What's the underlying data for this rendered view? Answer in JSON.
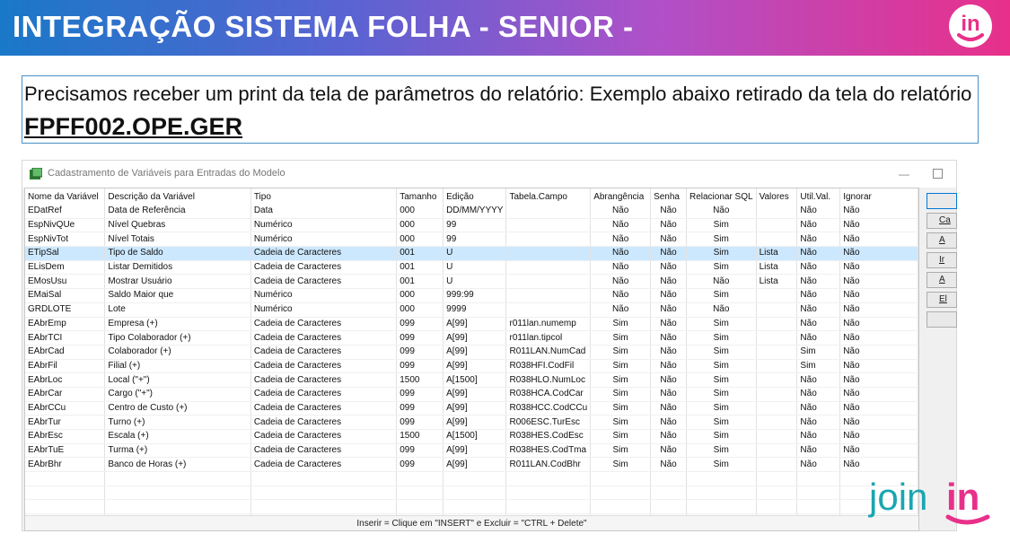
{
  "banner": {
    "title": "INTEGRAÇÃO SISTEMA FOLHA - SENIOR -"
  },
  "callout": {
    "text": "Precisamos receber um print da tela de parâmetros do relatório: Exemplo abaixo retirado da tela do relatório ",
    "report": "FPFF002.OPE.GER"
  },
  "window": {
    "title": "Cadastramento de Variáveis para Entradas do Modelo",
    "minimize": "—",
    "status": "Inserir = Clique em \"INSERT\"  e  Excluir = \"CTRL + Delete\""
  },
  "grid": {
    "columns": [
      "Nome da Variável",
      "Descrição da Variável",
      "Tipo",
      "Tamanho",
      "Edição",
      "Tabela.Campo",
      "Abrangência",
      "Senha",
      "Relacionar SQL",
      "Valores",
      "Util.Val.",
      "Ignorar"
    ],
    "rows": [
      [
        "EDatRef",
        "Data de Referência",
        "Data",
        "000",
        "DD/MM/YYYY",
        "",
        "Não",
        "Não",
        "Não",
        "",
        "Não",
        "Não"
      ],
      [
        "EspNivQUe",
        "Nível Quebras",
        "Numérico",
        "000",
        "99",
        "",
        "Não",
        "Não",
        "Sim",
        "",
        "Não",
        "Não"
      ],
      [
        "EspNivTot",
        "Nível Totais",
        "Numérico",
        "000",
        "99",
        "",
        "Não",
        "Não",
        "Sim",
        "",
        "Não",
        "Não"
      ],
      [
        "ETipSal",
        "Tipo de Saldo",
        "Cadeia de Caracteres",
        "001",
        "U",
        "",
        "Não",
        "Não",
        "Sim",
        "Lista",
        "Não",
        "Não"
      ],
      [
        "ELisDem",
        "Listar Demitidos",
        "Cadeia de Caracteres",
        "001",
        "U",
        "",
        "Não",
        "Não",
        "Sim",
        "Lista",
        "Não",
        "Não"
      ],
      [
        "EMosUsu",
        "Mostrar Usuário",
        "Cadeia de Caracteres",
        "001",
        "U",
        "",
        "Não",
        "Não",
        "Não",
        "Lista",
        "Não",
        "Não"
      ],
      [
        "EMaiSal",
        "Saldo Maior que",
        "Numérico",
        "000",
        "999:99",
        "",
        "Não",
        "Não",
        "Sim",
        "",
        "Não",
        "Não"
      ],
      [
        "GRDLOTE",
        "Lote",
        "Numérico",
        "000",
        "9999",
        "",
        "Não",
        "Não",
        "Não",
        "",
        "Não",
        "Não"
      ],
      [
        "EAbrEmp",
        "Empresa (+)",
        "Cadeia de Caracteres",
        "099",
        "A[99]",
        "r011lan.numemp",
        "Sim",
        "Não",
        "Sim",
        "",
        "Não",
        "Não"
      ],
      [
        "EAbrTCI",
        "Tipo Colaborador (+)",
        "Cadeia de Caracteres",
        "099",
        "A[99]",
        "r011lan.tipcol",
        "Sim",
        "Não",
        "Sim",
        "",
        "Não",
        "Não"
      ],
      [
        "EAbrCad",
        "Colaborador (+)",
        "Cadeia de Caracteres",
        "099",
        "A[99]",
        "R011LAN.NumCad",
        "Sim",
        "Não",
        "Sim",
        "",
        "Sim",
        "Não"
      ],
      [
        "EAbrFil",
        "Filial (+)",
        "Cadeia de Caracteres",
        "099",
        "A[99]",
        "R038HFI.CodFil",
        "Sim",
        "Não",
        "Sim",
        "",
        "Sim",
        "Não"
      ],
      [
        "EAbrLoc",
        "Local (\"+\")",
        "Cadeia de Caracteres",
        "1500",
        "A[1500]",
        "R038HLO.NumLoc",
        "Sim",
        "Não",
        "Sim",
        "",
        "Não",
        "Não"
      ],
      [
        "EAbrCar",
        "Cargo (\"+\")",
        "Cadeia de Caracteres",
        "099",
        "A[99]",
        "R038HCA.CodCar",
        "Sim",
        "Não",
        "Sim",
        "",
        "Não",
        "Não"
      ],
      [
        "EAbrCCu",
        "Centro de Custo (+)",
        "Cadeia de Caracteres",
        "099",
        "A[99]",
        "R038HCC.CodCCu",
        "Sim",
        "Não",
        "Sim",
        "",
        "Não",
        "Não"
      ],
      [
        "EAbrTur",
        "Turno (+)",
        "Cadeia de Caracteres",
        "099",
        "A[99]",
        "R006ESC.TurEsc",
        "Sim",
        "Não",
        "Sim",
        "",
        "Não",
        "Não"
      ],
      [
        "EAbrEsc",
        "Escala (+)",
        "Cadeia de Caracteres",
        "1500",
        "A[1500]",
        "R038HES.CodEsc",
        "Sim",
        "Não",
        "Sim",
        "",
        "Não",
        "Não"
      ],
      [
        "EAbrTuE",
        "Turma (+)",
        "Cadeia de Caracteres",
        "099",
        "A[99]",
        "R038HES.CodTma",
        "Sim",
        "Não",
        "Sim",
        "",
        "Não",
        "Não"
      ],
      [
        "EAbrBhr",
        "Banco de Horas (+)",
        "Cadeia de Caracteres",
        "099",
        "A[99]",
        "R011LAN.CodBhr",
        "Sim",
        "Não",
        "Sim",
        "",
        "Não",
        "Não"
      ]
    ],
    "selected_row": 3,
    "empty_rows": 5
  },
  "side_buttons": [
    "",
    "Ca",
    "A",
    "Ir",
    "A",
    "El"
  ],
  "colors": {
    "accent_blue": "#1a78c8",
    "accent_pink": "#e8308a",
    "selection": "#cce8ff"
  },
  "logos": {
    "corner": "in",
    "bottom": "joinin"
  }
}
